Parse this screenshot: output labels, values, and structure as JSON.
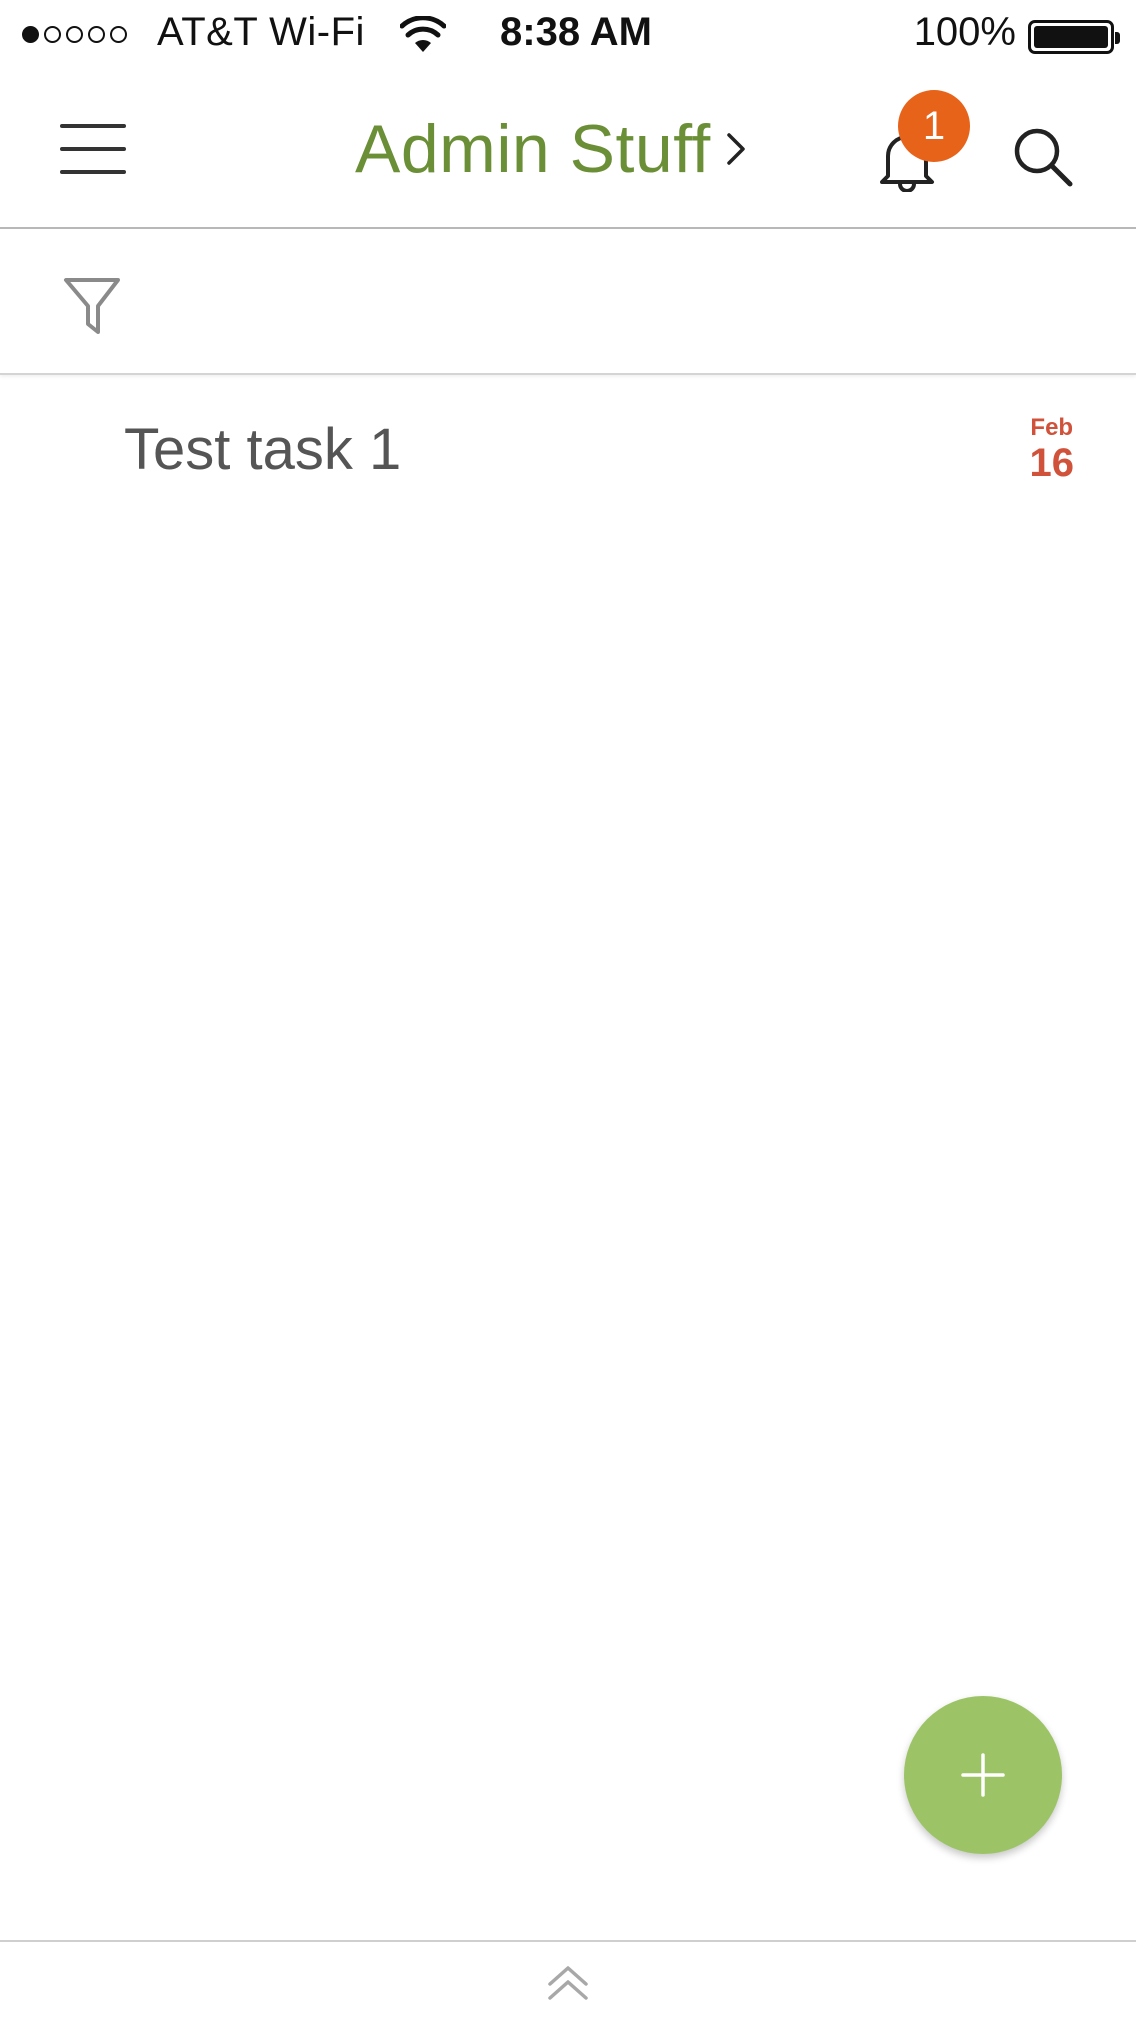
{
  "status_bar": {
    "carrier": "AT&T Wi-Fi",
    "time": "8:38 AM",
    "battery_percent": "100%",
    "signal_bars_filled": 1,
    "signal_bars_total": 5
  },
  "nav": {
    "title": "Admin Stuff",
    "title_color": "#6a8f36",
    "notification_count": "1",
    "badge_color": "#e8631a",
    "icons": {
      "menu": "hamburger-menu-icon",
      "chevron": "chevron-right-icon",
      "bell": "bell-icon",
      "search": "search-icon"
    }
  },
  "filter": {
    "icon": "filter-icon"
  },
  "tasks": [
    {
      "title": "Test task 1",
      "due_month": "Feb",
      "due_day": "16",
      "due_color": "#d0523a"
    }
  ],
  "fab": {
    "icon": "plus-icon",
    "color": "#9cc467"
  },
  "bottom_bar": {
    "icon": "double-chevron-up-icon"
  }
}
